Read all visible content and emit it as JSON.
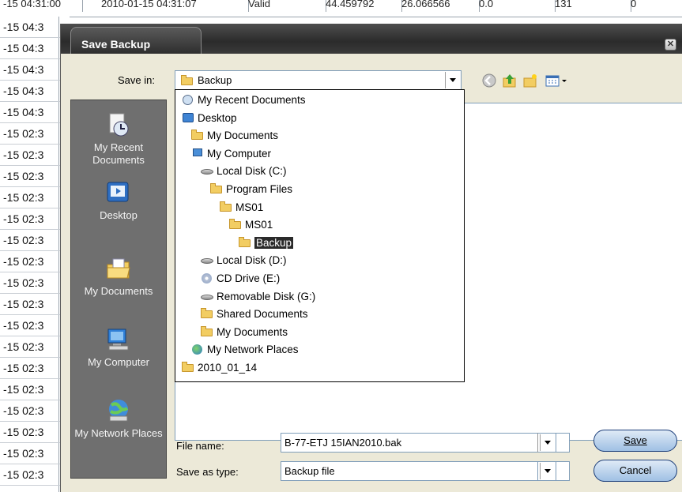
{
  "background": {
    "top_cells": [
      "-15 04:31:00",
      "2010-01-15 04:31:07",
      "Valid",
      "44.459792",
      "26.066566",
      "0.0",
      "131",
      "0"
    ],
    "rows": [
      "-15 04:3",
      "-15 04:3",
      "-15 04:3",
      "-15 04:3",
      "-15 04:3",
      "-15 02:3",
      "-15 02:3",
      "-15 02:3",
      "-15 02:3",
      "-15 02:3",
      "-15 02:3",
      "-15 02:3",
      "-15 02:3",
      "-15 02:3",
      "-15 02:3",
      "-15 02:3",
      "-15 02:3",
      "-15 02:3",
      "-15 02:3",
      "-15 02:3",
      "-15 02:3",
      "-15 02:3"
    ]
  },
  "dialog": {
    "title": "Save Backup",
    "close_icon": "close-icon",
    "save_in_label": "Save in:",
    "save_in_value": "Backup",
    "toolbar_icons": [
      "back-icon",
      "up-folder-icon",
      "new-folder-icon",
      "views-menu-icon"
    ],
    "places": [
      {
        "label": "My Recent Documents",
        "icon": "recent-documents-icon"
      },
      {
        "label": "Desktop",
        "icon": "desktop-icon"
      },
      {
        "label": "My Documents",
        "icon": "my-documents-icon"
      },
      {
        "label": "My Computer",
        "icon": "my-computer-icon"
      },
      {
        "label": "My Network Places",
        "icon": "network-places-icon"
      }
    ],
    "dropdown_items": [
      {
        "label": "My Recent Documents",
        "icon": "recent-icon"
      },
      {
        "label": "Desktop",
        "icon": "desktop-icon"
      },
      {
        "label": "My Documents",
        "icon": "folder-icon"
      },
      {
        "label": "My Computer",
        "icon": "computer-icon"
      },
      {
        "label": "Local Disk (C:)",
        "icon": "disk-icon"
      },
      {
        "label": "Program Files",
        "icon": "folder-icon"
      },
      {
        "label": "MS01",
        "icon": "folder-icon"
      },
      {
        "label": "MS01",
        "icon": "folder-icon"
      },
      {
        "label": "Backup",
        "icon": "folder-icon",
        "selected": true
      },
      {
        "label": "Local Disk (D:)",
        "icon": "disk-icon"
      },
      {
        "label": "CD Drive (E:)",
        "icon": "cd-icon"
      },
      {
        "label": "Removable Disk (G:)",
        "icon": "disk-icon"
      },
      {
        "label": "Shared Documents",
        "icon": "folder-icon"
      },
      {
        "label": "My Documents",
        "icon": "folder-icon"
      },
      {
        "label": "My Network Places",
        "icon": "network-icon"
      },
      {
        "label": "2010_01_14",
        "icon": "folder-icon"
      }
    ],
    "file_name_label": "File name:",
    "file_name_value": "B-77-ETJ 15IAN2010.bak",
    "save_as_type_label": "Save as type:",
    "save_as_type_value": "Backup file",
    "save_button": "Save",
    "cancel_button": "Cancel"
  }
}
